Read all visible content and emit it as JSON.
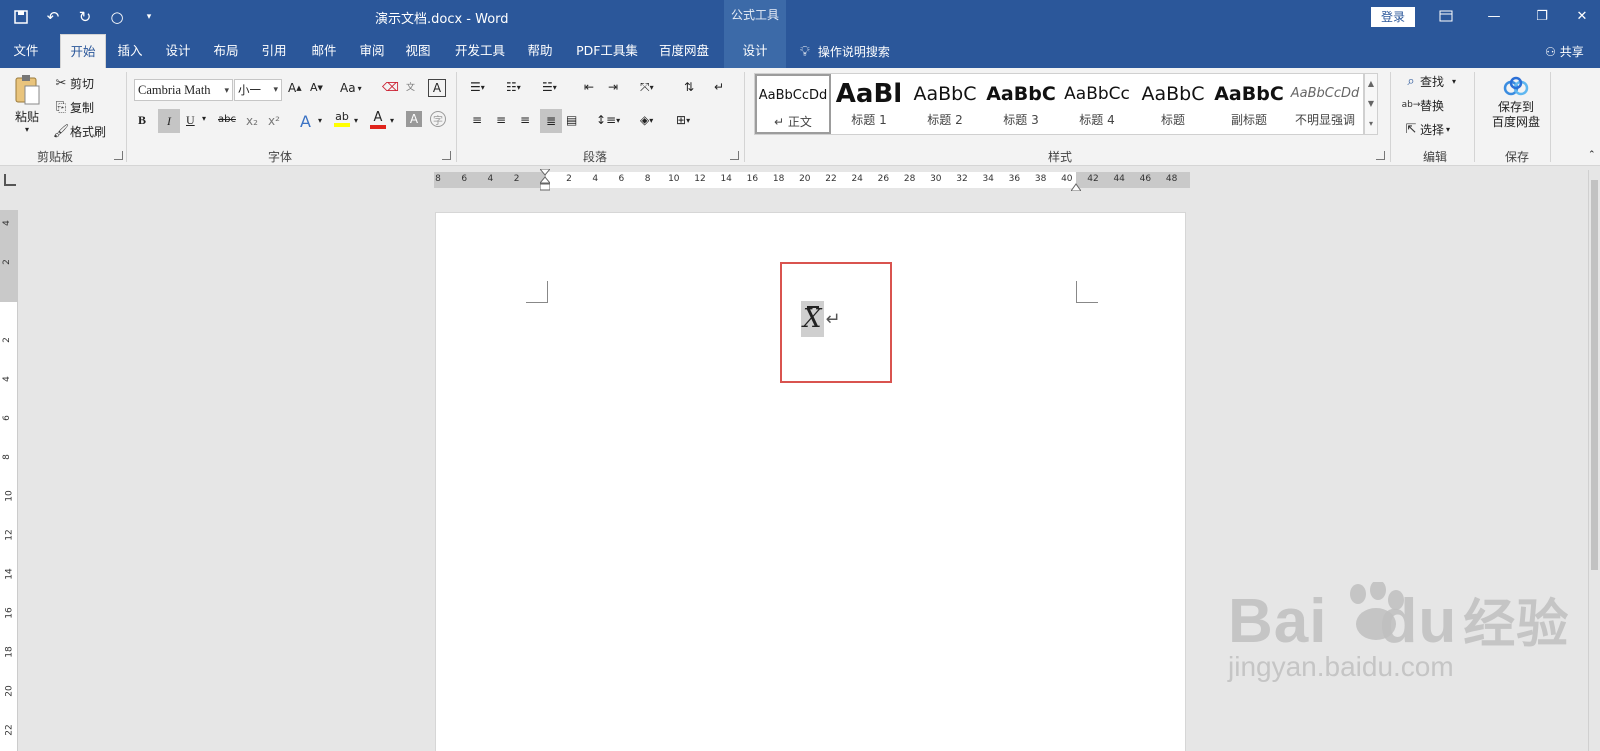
{
  "titlebar": {
    "doc_title": "演示文档.docx  -  Word",
    "contextual_title": "公式工具",
    "login": "登录"
  },
  "tabs": [
    "文件",
    "开始",
    "插入",
    "设计",
    "布局",
    "引用",
    "邮件",
    "审阅",
    "视图",
    "开发工具",
    "帮助",
    "PDF工具集",
    "百度网盘",
    "设计"
  ],
  "active_tab": "开始",
  "tellme": "操作说明搜索",
  "share": "共享",
  "clipboard": {
    "paste": "粘贴",
    "cut": "剪切",
    "copy": "复制",
    "format_painter": "格式刷",
    "label": "剪贴板"
  },
  "font": {
    "name": "Cambria Math",
    "size": "小一",
    "case": "Aa",
    "label": "字体",
    "bold": "B",
    "italic": "I",
    "underline": "U",
    "strike": "abc",
    "sub": "x₂",
    "sup": "x²"
  },
  "paragraph": {
    "label": "段落"
  },
  "styles": {
    "label": "样式",
    "items": [
      {
        "sample": "AaBbCcDd",
        "name": "正文"
      },
      {
        "sample": "AaBl",
        "name": "标题 1"
      },
      {
        "sample": "AaBbC",
        "name": "标题 2"
      },
      {
        "sample": "AaBbC",
        "name": "标题 3"
      },
      {
        "sample": "AaBbCc",
        "name": "标题 4"
      },
      {
        "sample": "AaBbC",
        "name": "标题"
      },
      {
        "sample": "AaBbC",
        "name": "副标题"
      },
      {
        "sample": "AaBbCcDd",
        "name": "不明显强调"
      }
    ]
  },
  "editing": {
    "label": "编辑",
    "find": "查找",
    "replace": "替换",
    "select": "选择"
  },
  "save_group": {
    "label": "保存",
    "button": "保存到\n百度网盘"
  },
  "ruler": {
    "top_numbers": [
      "8",
      "6",
      "4",
      "2",
      "",
      "2",
      "4",
      "6",
      "8",
      "10",
      "12",
      "14",
      "16",
      "18",
      "20",
      "22",
      "24",
      "26",
      "28",
      "30",
      "32",
      "34",
      "36",
      "38",
      "40",
      "42",
      "44",
      "46",
      "48"
    ],
    "left_numbers": [
      "4",
      "2",
      "",
      "2",
      "4",
      "6",
      "8",
      "10",
      "12",
      "14",
      "16",
      "18",
      "20",
      "22"
    ]
  },
  "document": {
    "equation": "X",
    "paragraph_mark": "↵"
  },
  "watermark": {
    "main": "Bai",
    "main2": "du",
    "cn": "经验",
    "url": "jingyan.baidu.com"
  }
}
